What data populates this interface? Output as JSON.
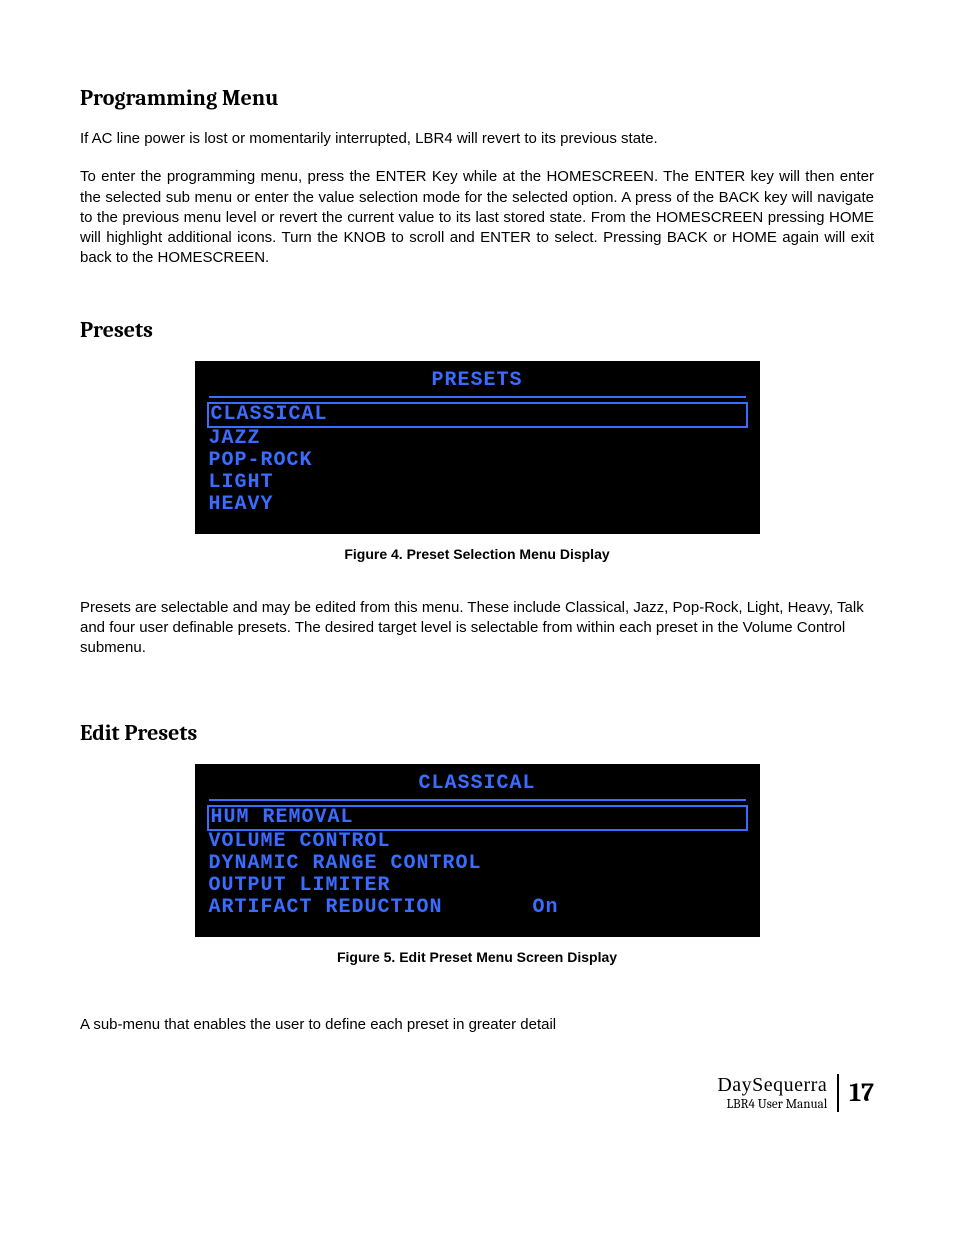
{
  "section1": {
    "heading": "Programming Menu",
    "para1": "If AC line power is lost or momentarily interrupted, LBR4 will revert to its previous state.",
    "para2": "To enter the programming menu, press the ENTER Key while at the HOMESCREEN. The ENTER key will then enter the selected sub menu or enter the value selection mode for the selected option. A press of the BACK key will navigate to the previous menu level or revert the current value to its last stored state.  From the HOMESCREEN pressing HOME will highlight additional icons.  Turn the KNOB to scroll and ENTER to select.  Pressing BACK or HOME again will exit back to the HOMESCREEN."
  },
  "section2": {
    "heading": "Presets",
    "display": {
      "title": "PRESETS",
      "items": [
        {
          "label": "CLASSICAL",
          "selected": true
        },
        {
          "label": "JAZZ",
          "selected": false
        },
        {
          "label": "POP-ROCK",
          "selected": false
        },
        {
          "label": "LIGHT",
          "selected": false
        },
        {
          "label": "HEAVY",
          "selected": false
        }
      ]
    },
    "caption": "Figure 4.    Preset Selection Menu Display",
    "para": "Presets are selectable and may be edited from this menu.  These include Classical, Jazz, Pop-Rock, Light, Heavy, Talk and four user definable presets.  The desired target level is selectable from within each preset in the Volume Control submenu."
  },
  "section3": {
    "heading": "Edit Presets",
    "display": {
      "title": "CLASSICAL",
      "items": [
        {
          "label": "HUM REMOVAL",
          "selected": true,
          "value": ""
        },
        {
          "label": "VOLUME CONTROL",
          "selected": false,
          "value": ""
        },
        {
          "label": "DYNAMIC RANGE CONTROL",
          "selected": false,
          "value": ""
        },
        {
          "label": "OUTPUT LIMITER",
          "selected": false,
          "value": ""
        },
        {
          "label": "ARTIFACT REDUCTION",
          "selected": false,
          "value": "On"
        }
      ]
    },
    "caption": "Figure 5.    Edit Preset Menu Screen Display",
    "para": "A sub-menu that enables the user to define each preset in greater detail"
  },
  "footer": {
    "brand": "DaySequerra",
    "manual": "LBR4 User Manual",
    "page": "17"
  }
}
